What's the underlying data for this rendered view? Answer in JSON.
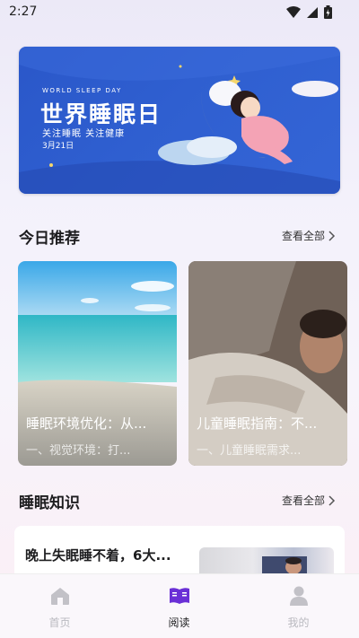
{
  "status": {
    "time": "2:27"
  },
  "banner": {
    "sub": "WORLD SLEEP DAY",
    "title": "世界睡眠日",
    "slogan": "关注睡眠  关注健康",
    "date": "3月21日"
  },
  "recommend": {
    "title": "今日推荐",
    "see_all": "查看全部",
    "cards": [
      {
        "title": "睡眠环境优化：从...",
        "desc": "一、视觉环境：打..."
      },
      {
        "title": "儿童睡眠指南：不...",
        "desc": "一、儿童睡眠需求..."
      }
    ]
  },
  "knowledge": {
    "title": "睡眠知识",
    "see_all": "查看全部",
    "articles": [
      {
        "title": "晚上失眠睡不着，6大..."
      }
    ]
  },
  "tabs": [
    {
      "label": "首页",
      "icon": "home-icon",
      "active": false
    },
    {
      "label": "阅读",
      "icon": "book-icon",
      "active": true
    },
    {
      "label": "我的",
      "icon": "profile-icon",
      "active": false
    }
  ],
  "colors": {
    "accent": "#6a2fd6",
    "inactive": "#b9b9bf",
    "banner": "#2f5fd0"
  }
}
